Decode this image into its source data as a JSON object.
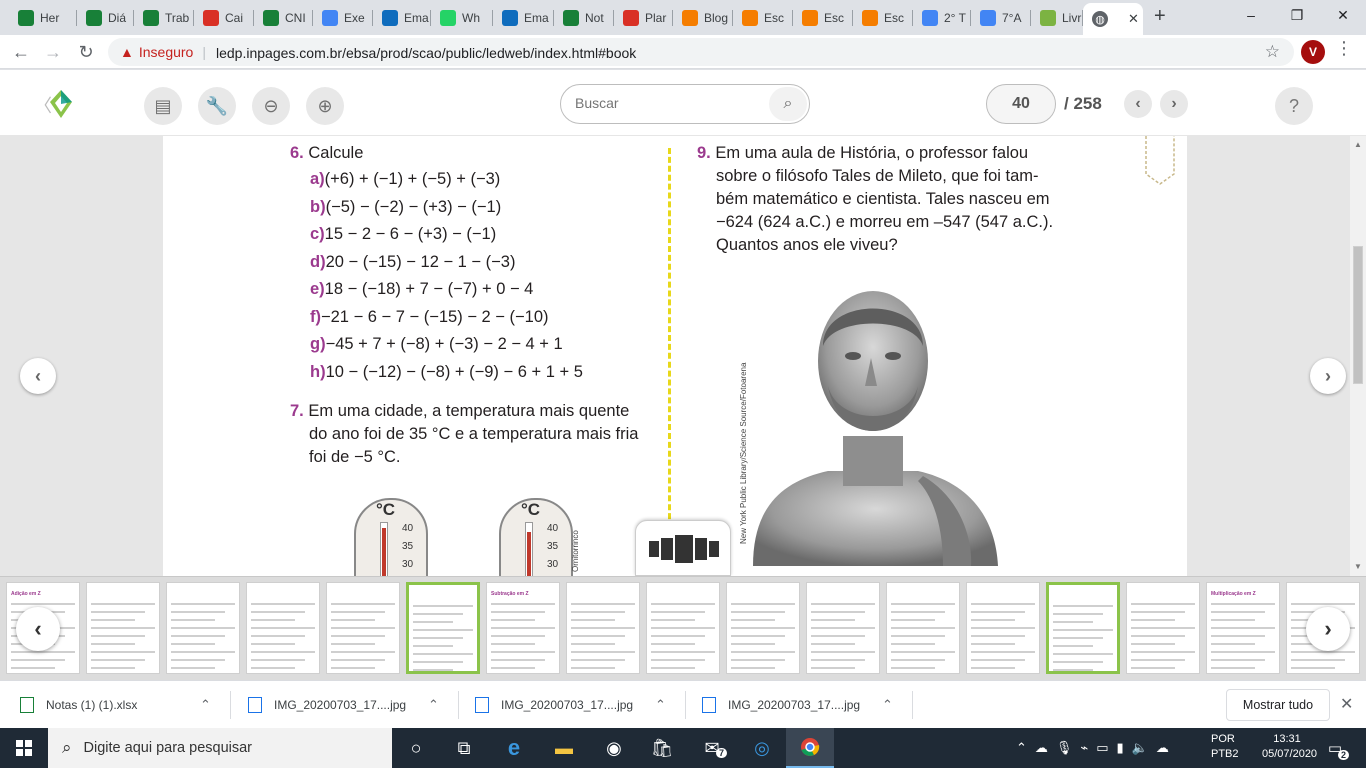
{
  "tabs": [
    {
      "label": "Her",
      "icon": "google-sheets-icon",
      "color": "#188038"
    },
    {
      "label": "Diá",
      "icon": "google-sheets-icon",
      "color": "#188038"
    },
    {
      "label": "Trab",
      "icon": "google-sheets-icon",
      "color": "#188038"
    },
    {
      "label": "Cai",
      "icon": "gmail-icon",
      "color": "#d93025"
    },
    {
      "label": "CNI",
      "icon": "google-sheets-icon",
      "color": "#188038"
    },
    {
      "label": "Exe",
      "icon": "google-docs-icon",
      "color": "#4285f4"
    },
    {
      "label": "Ema",
      "icon": "outlook-icon",
      "color": "#0f6cbd"
    },
    {
      "label": "Wh",
      "icon": "whatsapp-icon",
      "color": "#25d366"
    },
    {
      "label": "Ema",
      "icon": "outlook-icon",
      "color": "#0f6cbd"
    },
    {
      "label": "Not",
      "icon": "google-sheets-icon",
      "color": "#188038"
    },
    {
      "label": "Plar",
      "icon": "gmail-icon",
      "color": "#d93025"
    },
    {
      "label": "Blog",
      "icon": "blogger-icon",
      "color": "#f57d00"
    },
    {
      "label": "Esc",
      "icon": "blogger-icon",
      "color": "#f57d00"
    },
    {
      "label": "Esc",
      "icon": "blogger-icon",
      "color": "#f57d00"
    },
    {
      "label": "Esc",
      "icon": "blogger-icon",
      "color": "#f57d00"
    },
    {
      "label": "2° T",
      "icon": "google-docs-icon",
      "color": "#4285f4"
    },
    {
      "label": "7°A",
      "icon": "google-docs-icon",
      "color": "#4285f4"
    },
    {
      "label": "Livr",
      "icon": "ledp-icon",
      "color": "#7cb342"
    }
  ],
  "new_tab_symbol": "+",
  "window": {
    "minimize": "–",
    "maximize": "❐",
    "close": "✕"
  },
  "omnibox": {
    "security": "Inseguro",
    "url": "ledp.inpages.com.br/ebsa/prod/scao/public/ledweb/index.html#book"
  },
  "profile_initial": "V",
  "reader": {
    "search_placeholder": "Buscar",
    "current_page": "40",
    "total_pages": "/ 258",
    "help": "?"
  },
  "book": {
    "q6": {
      "num": "6.",
      "text": "Calcule"
    },
    "q6_items": [
      {
        "label": "a)",
        "expr": "(+6) + (−1) + (−5) + (−3)"
      },
      {
        "label": "b)",
        "expr": "(−5) − (−2) − (+3) − (−1)"
      },
      {
        "label": "c)",
        "expr": "15 − 2 − 6 − (+3) − (−1)"
      },
      {
        "label": "d)",
        "expr": "20 − (−15) − 12 − 1 − (−3)"
      },
      {
        "label": "e)",
        "expr": "18 − (−18) + 7 − (−7) + 0 − 4"
      },
      {
        "label": "f)",
        "expr": "−21 − 6 − 7 − (−15) − 2 − (−10)"
      },
      {
        "label": "g)",
        "expr": "−45 + 7 + (−8) + (−3) − 2 − 4 + 1"
      },
      {
        "label": "h)",
        "expr": "10 − (−12) − (−8) + (−9) − 6 + 1 + 5"
      }
    ],
    "q7": {
      "num": "7.",
      "lines": [
        "Em uma cidade, a temperatura mais quente",
        "do ano foi de 35 °C e a temperatura mais fria",
        "foi de −5 °C."
      ]
    },
    "q9": {
      "num": "9.",
      "lines": [
        "Em uma aula de História, o professor falou",
        "sobre o filósofo Tales de Mileto, que foi tam-",
        "bém matemático e cientista. Tales nasceu em",
        "−624 (624 a.C.) e morreu em –547 (547 a.C.).",
        "Quantos anos ele viveu?"
      ]
    },
    "thermo_unit": "°C",
    "thermo_ticks": [
      "40",
      "35",
      "30"
    ],
    "photo_credit": "New York Public Library/Science Source/Fotoarena",
    "illustration_credit": "Ornitorrinco"
  },
  "thumbnails": [
    {
      "title": "Adição em Z"
    },
    {
      "title": ""
    },
    {
      "title": ""
    },
    {
      "title": ""
    },
    {
      "title": ""
    },
    {
      "title": ""
    },
    {
      "title": "Subtração em Z"
    },
    {
      "title": ""
    },
    {
      "title": ""
    },
    {
      "title": ""
    },
    {
      "title": ""
    },
    {
      "title": ""
    },
    {
      "title": ""
    },
    {
      "title": ""
    },
    {
      "title": ""
    },
    {
      "title": "Multiplicação em Z"
    },
    {
      "title": ""
    },
    {
      "title": ""
    }
  ],
  "downloads": [
    {
      "name": "Notas (1) (1).xlsx",
      "type": "xlsx"
    },
    {
      "name": "IMG_20200703_17....jpg",
      "type": "jpg"
    },
    {
      "name": "IMG_20200703_17....jpg",
      "type": "jpg"
    },
    {
      "name": "IMG_20200703_17....jpg",
      "type": "jpg"
    }
  ],
  "show_all": "Mostrar tudo",
  "taskbar": {
    "search_placeholder": "Digite aqui para pesquisar",
    "mail_badge": "7",
    "lang_1": "POR",
    "lang_2": "PTB2",
    "time": "13:31",
    "date": "05/07/2020",
    "notifications": "2"
  }
}
